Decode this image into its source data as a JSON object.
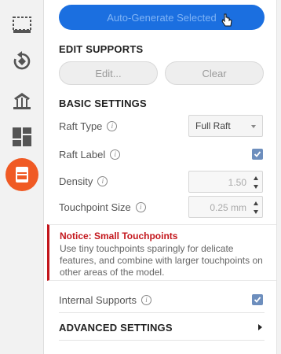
{
  "toolbar": {
    "tools": [
      {
        "name": "select-tool",
        "icon": "select-box-icon"
      },
      {
        "name": "orient-tool",
        "icon": "rotate-icon"
      },
      {
        "name": "supports-tool",
        "icon": "support-icon"
      },
      {
        "name": "layout-tool",
        "icon": "layout-grid-icon"
      },
      {
        "name": "print-tool",
        "icon": "printer-icon",
        "active": true,
        "color": "#f05a24"
      }
    ]
  },
  "panel": {
    "auto_generate_label": "Auto-Generate Selected",
    "edit_supports": {
      "title": "EDIT SUPPORTS",
      "edit_label": "Edit...",
      "clear_label": "Clear"
    },
    "basic_settings": {
      "title": "BASIC SETTINGS",
      "raft_type_label": "Raft Type",
      "raft_type_value": "Full Raft",
      "raft_label_label": "Raft Label",
      "raft_label_checked": true,
      "density_label": "Density",
      "density_value": "1.50",
      "touchpoint_size_label": "Touchpoint Size",
      "touchpoint_size_value": "0.25 mm"
    },
    "notice": {
      "title": "Notice: Small Touchpoints",
      "body": "Use tiny touchpoints sparingly for delicate features, and combine with larger touchpoints on other areas of the model.",
      "color": "#c3161c"
    },
    "internal_supports_label": "Internal Supports",
    "internal_supports_checked": true,
    "advanced_settings_title": "ADVANCED SETTINGS",
    "info_glyph": "i",
    "accent_color": "#1b6fe0"
  }
}
